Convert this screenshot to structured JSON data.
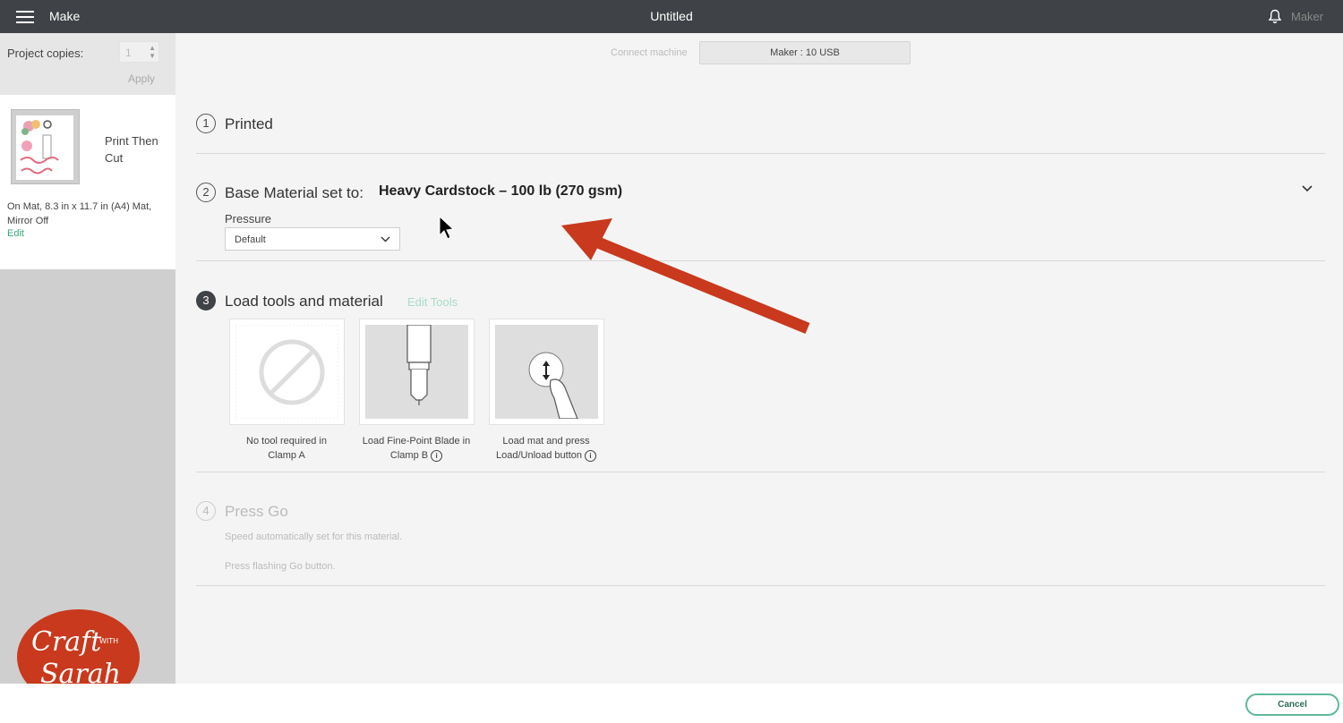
{
  "header": {
    "menu_label": "Make",
    "title": "Untitled",
    "account": "Maker"
  },
  "sidebar": {
    "copies_label": "Project copies:",
    "copies_value": "1",
    "apply_label": "Apply",
    "mat": {
      "label": "Print Then Cut",
      "details": "On Mat, 8.3 in x 11.7 in (A4) Mat, Mirror Off",
      "edit_label": "Edit"
    },
    "logo_text": {
      "line1": "Craft",
      "with": "WITH",
      "line2": "Sarah"
    }
  },
  "connection": {
    "label": "Connect machine",
    "machine": "Maker : 10 USB"
  },
  "steps": {
    "step1": {
      "number": "1",
      "title": "Printed"
    },
    "step2": {
      "number": "2",
      "title": "Base Material set to:",
      "material": "Heavy Cardstock – 100 lb (270 gsm)",
      "pressure_label": "Pressure",
      "pressure_value": "Default"
    },
    "step3": {
      "number": "3",
      "title": "Load tools and material",
      "edit_tools": "Edit Tools",
      "tools": [
        {
          "caption_line1": "No tool required in",
          "caption_line2": "Clamp A"
        },
        {
          "caption_line1": "Load Fine-Point Blade in",
          "caption_line2": "Clamp B"
        },
        {
          "caption_line1": "Load mat and press",
          "caption_line2": "Load/Unload button"
        }
      ]
    },
    "step4": {
      "number": "4",
      "title": "Press Go",
      "line1": "Speed automatically set for this material.",
      "line2": "Press flashing Go button."
    }
  },
  "footer": {
    "cancel_label": "Cancel"
  },
  "colors": {
    "topbar": "#3f4246",
    "accent_green": "#37a877",
    "arrow_red": "#c8391d"
  }
}
